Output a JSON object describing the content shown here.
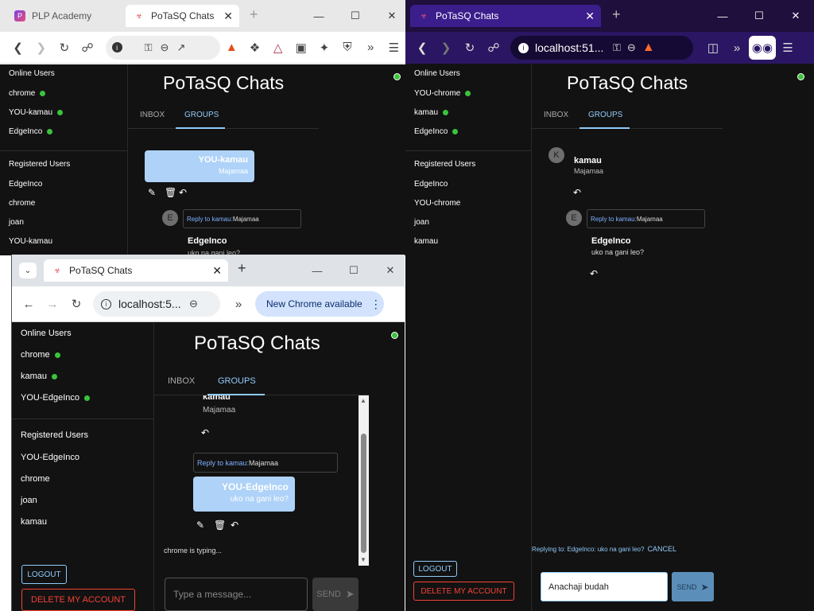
{
  "left_window": {
    "tabs": [
      {
        "title": "PLP Academy"
      },
      {
        "title": "PoTaSQ Chats"
      }
    ],
    "toolbar_icons": [
      "back-icon",
      "forward-icon",
      "reload-icon",
      "bookmark-icon",
      "info-icon",
      "key-icon",
      "zoom-out-icon",
      "share-icon",
      "brave-icon",
      "extension-icon",
      "triangle-icon",
      "wallet-icon",
      "sparkle-icon",
      "shield-icon",
      "more-icon",
      "menu-icon"
    ],
    "app": {
      "title": "PoTaSQ Chats",
      "tabs": [
        "INBOX",
        "GROUPS"
      ],
      "online_header": "Online Users",
      "online_users": [
        "chrome",
        "YOU-kamau",
        "EdgeInco"
      ],
      "registered_header": "Registered Users",
      "registered_users": [
        "EdgeInco",
        "chrome",
        "joan",
        "YOU-kamau"
      ],
      "messages": {
        "own_name": "YOU-kamau",
        "own_text": "Majamaa",
        "reply_avatar": "E",
        "reply_prefix": "Reply to kamau:",
        "reply_quote": "Majamaa",
        "reply_name": "EdgeInco",
        "reply_text": "uko na gani leo?"
      }
    }
  },
  "right_window": {
    "tab_title": "PoTaSQ Chats",
    "address": "localhost:51...",
    "app": {
      "title": "PoTaSQ Chats",
      "tabs": [
        "INBOX",
        "GROUPS"
      ],
      "online_header": "Online Users",
      "online_users": [
        "YOU-chrome",
        "kamau",
        "EdgeInco"
      ],
      "registered_header": "Registered Users",
      "registered_users": [
        "EdgeInco",
        "YOU-chrome",
        "joan",
        "kamau"
      ],
      "messages": {
        "msg1_avatar": "K",
        "msg1_name": "kamau",
        "msg1_text": "Majamaa",
        "msg2_avatar": "E",
        "reply_prefix": "Reply to kamau:",
        "reply_quote": "Majamaa",
        "msg2_name": "EdgeInco",
        "msg2_text": "uko na gani leo?"
      },
      "replying_to": "Replying to: EdgeInco: uko na gani leo?",
      "cancel_label": "CANCEL",
      "input_value": "Anachaji budah",
      "send_label": "SEND",
      "logout_label": "LOGOUT",
      "delete_label": "DELETE MY ACCOUNT"
    }
  },
  "chrome_window": {
    "tab_title": "PoTaSQ Chats",
    "address": "localhost:5...",
    "update_label": "New Chrome available",
    "app": {
      "title": "PoTaSQ Chats",
      "tabs": [
        "INBOX",
        "GROUPS"
      ],
      "online_header": "Online Users",
      "online_users": [
        "chrome",
        "kamau",
        "YOU-EdgeInco"
      ],
      "registered_header": "Registered Users",
      "registered_users": [
        "YOU-EdgeInco",
        "chrome",
        "joan",
        "kamau"
      ],
      "messages": {
        "msg1_name": "kamau",
        "msg1_text": "Majamaa",
        "reply_prefix": "Reply to kamau:",
        "reply_quote": "Majamaa",
        "own_name": "YOU-EdgeInco",
        "own_text": "uko na gani leo?"
      },
      "typing": "chrome is typing...",
      "input_placeholder": "Type a message...",
      "send_label": "SEND",
      "logout_label": "LOGOUT",
      "delete_label": "DELETE MY ACCOUNT"
    }
  },
  "colors": {
    "accent_blue": "#90caf9",
    "online_green": "#3bc43b",
    "danger_red": "#f44336",
    "bubble_bg": "#aed2f8",
    "app_bg": "#121212"
  }
}
